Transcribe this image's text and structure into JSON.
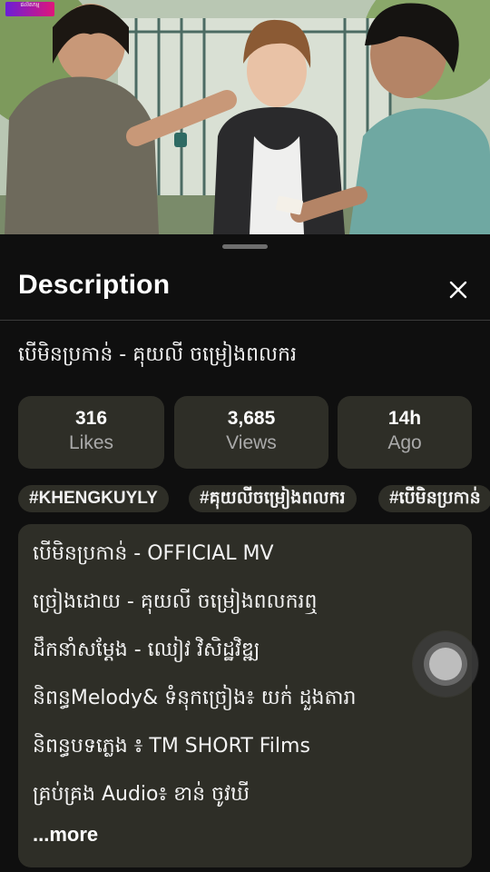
{
  "video": {
    "channel_logo_text": "ផលិតកម្ម"
  },
  "sheet": {
    "title": "Description",
    "video_title": "បើមិនប្រកាន់ - គុយលី ចម្រៀងពលករ"
  },
  "stats": [
    {
      "value": "316",
      "label": "Likes"
    },
    {
      "value": "3,685",
      "label": "Views"
    },
    {
      "value": "14h",
      "label": "Ago"
    }
  ],
  "hashtags": [
    "#KHENGKUYLY",
    "#គុយលីចម្រៀងពលករ",
    "#បើមិនប្រកាន់"
  ],
  "description": {
    "lines": [
      "បើមិនប្រកាន់ - OFFICIAL MV",
      "ច្រៀងដោយ - គុយលី ចម្រៀងពលករឮ",
      "ដឹកនាំសម្ដែង - ឈៀវ វិសិដ្ឋវិឌ្ឍ",
      "និពន្ធMelody& ទំនុកច្រៀង៖ យក់ ដួងតារា",
      "និពន្ធបទភ្លេង ៖ TM SHORT  Films",
      "គ្រប់គ្រង Audio៖ ខាន់ ចូវឃី"
    ],
    "more_label": "...more"
  },
  "icons": {
    "close": "close-icon",
    "floating": "floating-action-icon"
  },
  "colors": {
    "background": "#0f0f0f",
    "card": "#2e2e27",
    "secondary_text": "#aaaaaa"
  }
}
